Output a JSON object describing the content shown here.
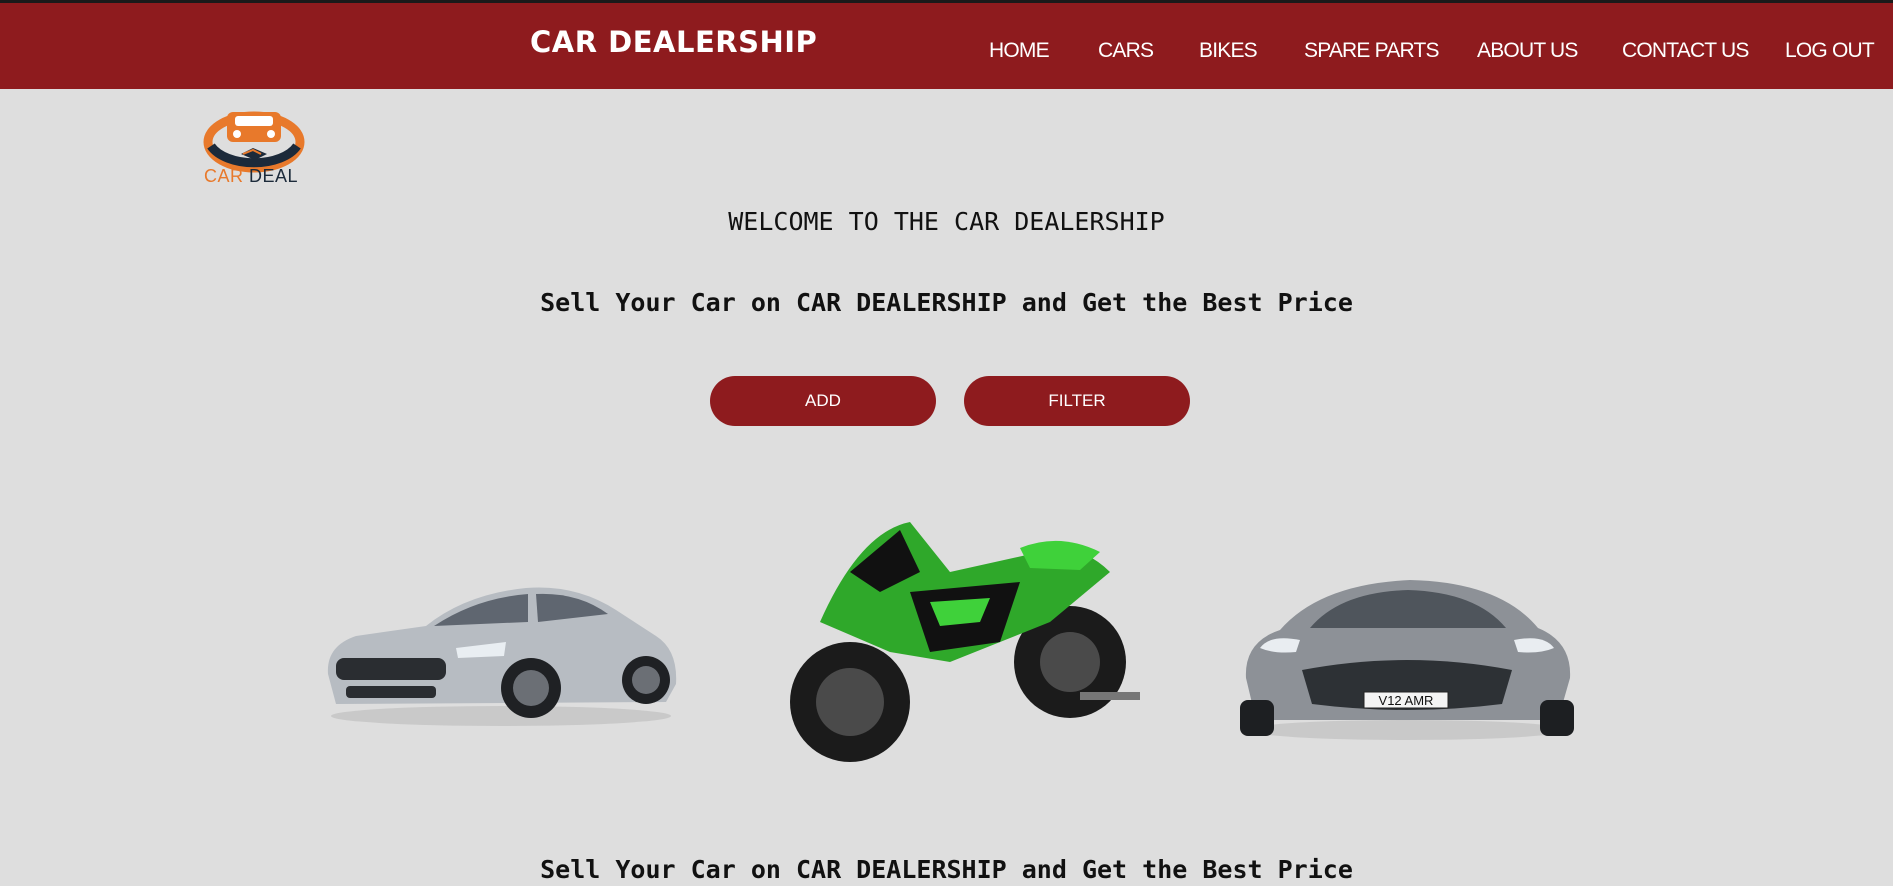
{
  "header": {
    "brand": "CAR DEALERSHIP",
    "nav": [
      "HOME",
      "CARS",
      "BIKES",
      "SPARE PARTS",
      "ABOUT US",
      "CONTACT US",
      "LOG OUT"
    ]
  },
  "logo": {
    "text_a": "CAR",
    "text_b": "DEAL"
  },
  "main": {
    "welcome": "WELCOME TO THE CAR DEALERSHIP",
    "tagline": "Sell Your Car on CAR DEALERSHIP and Get the Best Price",
    "add_label": "ADD",
    "filter_label": "FILTER",
    "tagline_bottom": "Sell Your Car on CAR DEALERSHIP and Get the Best Price"
  },
  "vehicles": {
    "car1_plate": "V12 AMR"
  },
  "colors": {
    "accent": "#8e1b1e",
    "background": "#dedede",
    "logo_orange": "#e8792b"
  }
}
